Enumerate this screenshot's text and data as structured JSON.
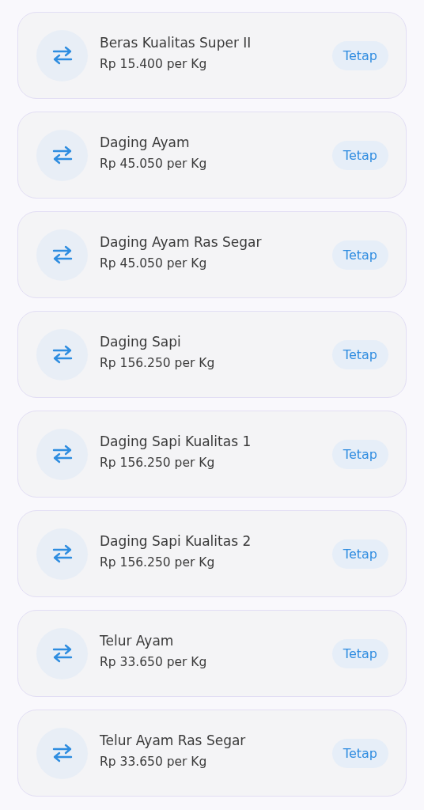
{
  "items": [
    {
      "name": "Beras Kualitas Super II",
      "price": "Rp 15.400 per Kg",
      "status": "Tetap"
    },
    {
      "name": "Daging Ayam",
      "price": "Rp 45.050 per Kg",
      "status": "Tetap"
    },
    {
      "name": "Daging Ayam Ras Segar",
      "price": "Rp 45.050 per Kg",
      "status": "Tetap"
    },
    {
      "name": "Daging Sapi",
      "price": "Rp 156.250 per Kg",
      "status": "Tetap"
    },
    {
      "name": "Daging Sapi Kualitas 1",
      "price": "Rp 156.250 per Kg",
      "status": "Tetap"
    },
    {
      "name": "Daging Sapi Kualitas 2",
      "price": "Rp 156.250 per Kg",
      "status": "Tetap"
    },
    {
      "name": "Telur Ayam",
      "price": "Rp 33.650 per Kg",
      "status": "Tetap"
    },
    {
      "name": "Telur Ayam Ras Segar",
      "price": "Rp 33.650 per Kg",
      "status": "Tetap"
    }
  ]
}
